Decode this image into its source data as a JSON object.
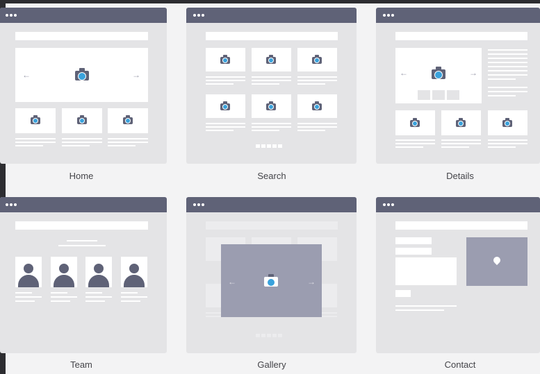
{
  "screens": [
    {
      "id": "home",
      "caption": "Home"
    },
    {
      "id": "search",
      "caption": "Search"
    },
    {
      "id": "details",
      "caption": "Details"
    },
    {
      "id": "team",
      "caption": "Team"
    },
    {
      "id": "gallery",
      "caption": "Gallery"
    },
    {
      "id": "contact",
      "caption": "Contact"
    }
  ],
  "arrows": {
    "left": "←",
    "right": "→"
  },
  "colors": {
    "titlebar": "#5f6277",
    "window": "#e4e4e6",
    "block": "#ffffff",
    "accent": "#3aa2dc",
    "placeholder": "#9b9db0"
  },
  "icons": {
    "camera": "camera-icon",
    "person": "person-icon",
    "map_pin": "map-pin-icon"
  }
}
